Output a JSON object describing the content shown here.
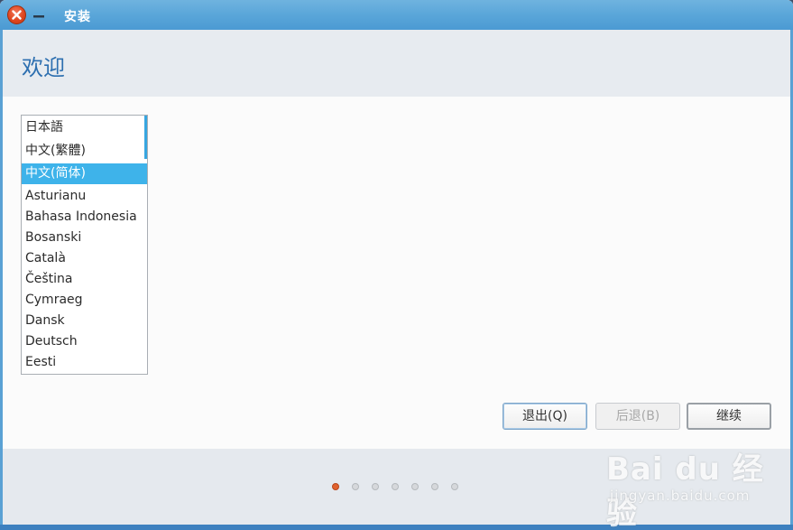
{
  "window": {
    "title": "安装",
    "close_icon": "close-icon",
    "minimize_icon": "minimize-icon"
  },
  "header": {
    "title": "欢迎"
  },
  "language_list": {
    "items": [
      "日本語",
      "中文(繁體)",
      "中文(简体)",
      "Asturianu",
      "Bahasa Indonesia",
      "Bosanski",
      "Català",
      "Čeština",
      "Cymraeg",
      "Dansk",
      "Deutsch",
      "Eesti"
    ],
    "selected": "中文(简体)"
  },
  "buttons": {
    "quit": "退出(Q)",
    "back": "后退(B)",
    "next": "继续"
  },
  "progress": {
    "total_steps": 7,
    "current_step": 1
  },
  "watermark": {
    "logo": "Bai du 经验",
    "url": "jingyan.baidu.com"
  },
  "colors": {
    "accent": "#3eb3ea",
    "title_blue": "#2d6fb0",
    "active_dot": "#e0622e"
  }
}
